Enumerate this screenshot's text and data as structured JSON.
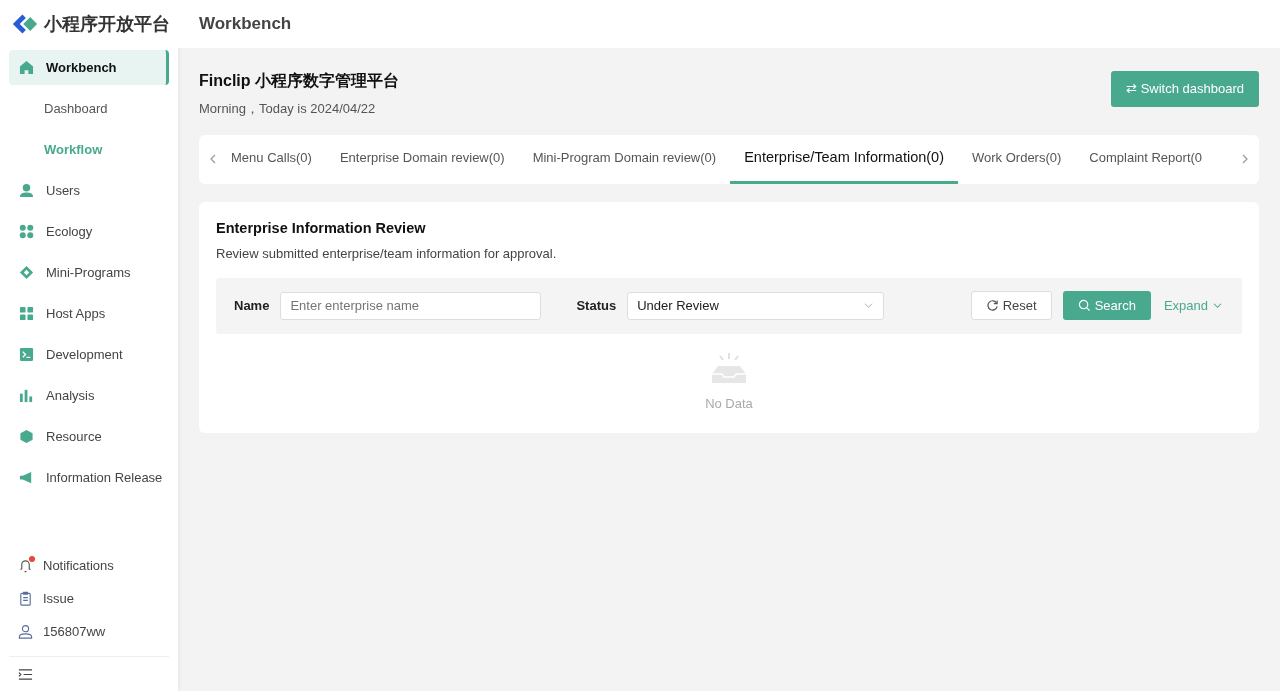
{
  "brand": {
    "name": "小程序开放平台"
  },
  "header": {
    "title": "Workbench"
  },
  "sidebar": {
    "items": [
      {
        "label": "Workbench",
        "selected": true,
        "children": [
          {
            "label": "Dashboard",
            "selected": false
          },
          {
            "label": "Workflow",
            "selected": true
          }
        ]
      },
      {
        "label": "Users",
        "selected": false
      },
      {
        "label": "Ecology",
        "selected": false
      },
      {
        "label": "Mini-Programs",
        "selected": false
      },
      {
        "label": "Host Apps",
        "selected": false
      },
      {
        "label": "Development",
        "selected": false
      },
      {
        "label": "Analysis",
        "selected": false
      },
      {
        "label": "Resource",
        "selected": false
      },
      {
        "label": "Information Release",
        "selected": false
      }
    ],
    "footer": [
      {
        "label": "Notifications",
        "unread": true
      },
      {
        "label": "Issue",
        "unread": false
      },
      {
        "label": "156807ww",
        "unread": false
      }
    ]
  },
  "page": {
    "title": "Finclip 小程序数字管理平台",
    "greeting": "Morning，Today is 2024/04/22",
    "switch_button": "⇄ Switch dashboard"
  },
  "tabs": [
    {
      "label": "Menu Calls(0)",
      "selected": false
    },
    {
      "label": "Enterprise Domain review(0)",
      "selected": false
    },
    {
      "label": "Mini-Program Domain review(0)",
      "selected": false
    },
    {
      "label": "Enterprise/Team Information(0)",
      "selected": true
    },
    {
      "label": "Work Orders(0)",
      "selected": false
    },
    {
      "label": "Complaint Report(0",
      "selected": false
    }
  ],
  "panel": {
    "title": "Enterprise Information Review",
    "description": "Review submitted enterprise/team information for approval.",
    "filters": {
      "name_label": "Name",
      "name_placeholder": "Enter enterprise name",
      "status_label": "Status",
      "status_value": "Under Review",
      "reset": "Reset",
      "search": "Search",
      "expand": "Expand"
    },
    "empty": "No Data"
  }
}
